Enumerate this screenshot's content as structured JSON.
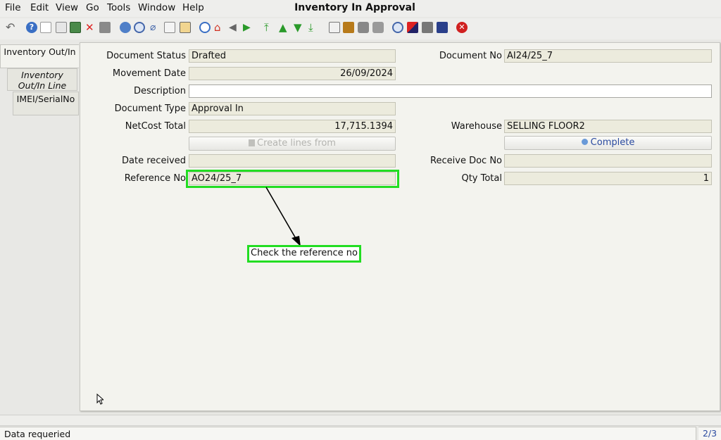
{
  "menu": {
    "file": "File",
    "edit": "Edit",
    "view": "View",
    "go": "Go",
    "tools": "Tools",
    "window": "Window",
    "help": "Help"
  },
  "window_title": "Inventory In Approval",
  "toolbar_icons": [
    "undo-icon",
    "help-icon",
    "new-icon",
    "copy-icon",
    "save-icon",
    "delete-icon",
    "print-preview-icon",
    "refresh-icon",
    "find-icon",
    "attachment-icon",
    "chat-icon",
    "history-icon",
    "home-icon",
    "back-icon",
    "forward-icon",
    "first-record-icon",
    "previous-record-icon",
    "next-record-icon",
    "last-record-icon",
    "report-icon",
    "archive-icon",
    "print-icon",
    "print-direct-icon",
    "zoom-across-icon",
    "translate-icon",
    "workflow-icon",
    "product-info-icon",
    "end-icon"
  ],
  "tabs": [
    {
      "label": "Inventory Out/In"
    },
    {
      "label": "Inventory Out/In Line"
    },
    {
      "label": "IMEI/SerialNo"
    }
  ],
  "form": {
    "document_status": {
      "label": "Document Status",
      "value": "Drafted"
    },
    "movement_date": {
      "label": "Movement Date",
      "value": "26/09/2024"
    },
    "description": {
      "label": "Description",
      "value": ""
    },
    "document_type": {
      "label": "Document Type",
      "value": "Approval In"
    },
    "netcost_total": {
      "label": "NetCost Total",
      "value": "17,715.1394"
    },
    "create_lines_button": "Create lines from",
    "date_received": {
      "label": "Date received",
      "value": ""
    },
    "reference_no": {
      "label": "Reference No",
      "value": "AO24/25_7"
    },
    "document_no": {
      "label": "Document No",
      "value": "AI24/25_7"
    },
    "warehouse": {
      "label": "Warehouse",
      "value": "SELLING FLOOR2"
    },
    "complete_button": "Complete",
    "receive_doc_no": {
      "label": "Receive Doc No",
      "value": ""
    },
    "qty_total": {
      "label": "Qty Total",
      "value": "1"
    }
  },
  "annotation": {
    "text": "Check the reference no",
    "color": "#22dd22"
  },
  "status": {
    "message": "Data requeried",
    "page": "2/3"
  },
  "colors": {
    "readonly_field": "#ecebdd",
    "panel": "#f3f3ee",
    "link_blue": "#2a4aa0",
    "highlight": "#22dd22"
  }
}
